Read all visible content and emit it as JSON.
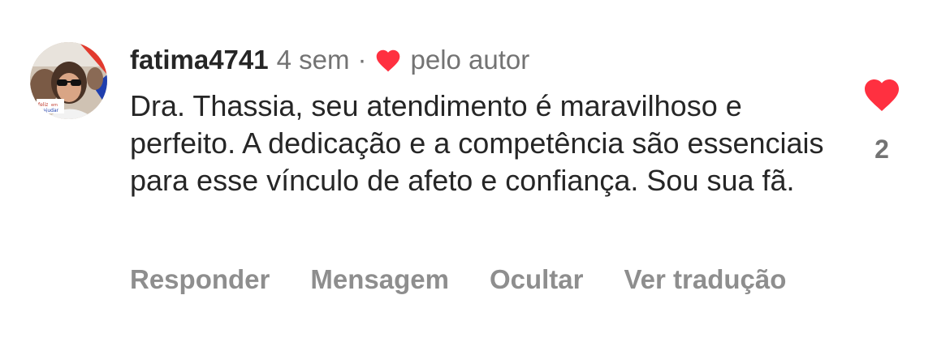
{
  "comment": {
    "username": "fatima4741",
    "time": "4 sem",
    "separator": "·",
    "author_like": "pelo autor",
    "text": "Dra. Thassia, seu atendimento é maravilhoso e perfeito. A dedicação e a competência são essenciais para esse vínculo de afeto e confiança. Sou sua fã.",
    "like_count": "2",
    "avatar_badge_icon": "heart-icon",
    "avatar_badge_text_line1": "feliz",
    "avatar_badge_text_line2": "em",
    "avatar_badge_text_line3": "ajudar"
  },
  "actions": {
    "reply": "Responder",
    "message": "Mensagem",
    "hide": "Ocultar",
    "translate": "Ver tradução"
  },
  "colors": {
    "heart": "#ff3040",
    "username": "#262626",
    "secondary_text": "#737373",
    "actions_text": "#8e8e8e"
  }
}
